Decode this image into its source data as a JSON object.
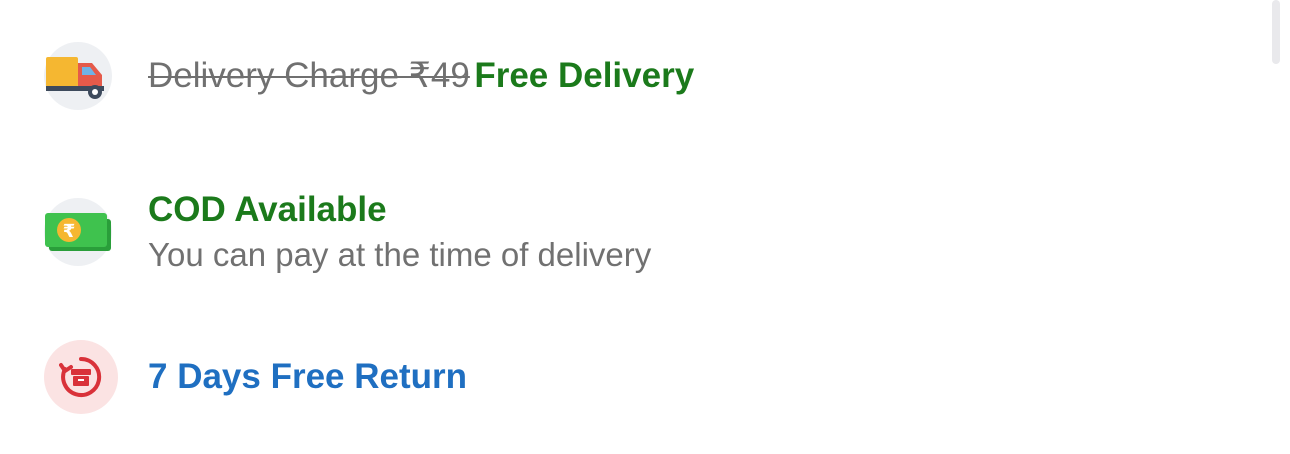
{
  "delivery": {
    "original_charge": "Delivery Charge ₹49",
    "free_label": "Free Delivery",
    "icon": "delivery-truck-icon"
  },
  "cod": {
    "title": "COD Available",
    "subtitle": "You can pay at the time of delivery",
    "icon": "rupee-cash-icon",
    "currency_symbol": "₹"
  },
  "returns": {
    "title": "7 Days Free Return",
    "icon": "return-box-icon"
  },
  "colors": {
    "green": "#1b7a1b",
    "blue": "#1f6fc1",
    "grey_text": "#717171",
    "return_red": "#d9323a"
  }
}
